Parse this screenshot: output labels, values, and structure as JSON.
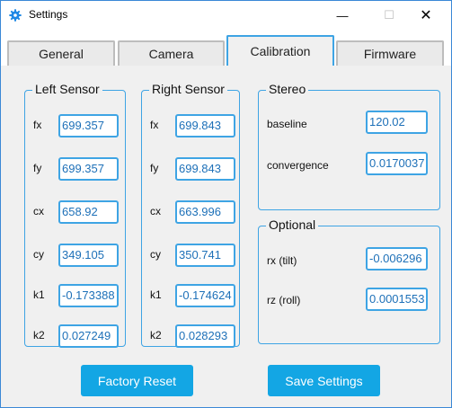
{
  "window": {
    "title": "Settings",
    "icon": "gear-icon",
    "minimize_glyph": "—",
    "maximize_glyph": "☐",
    "close_glyph": "✕"
  },
  "tabs": [
    {
      "label": "General",
      "active": false
    },
    {
      "label": "Camera",
      "active": false
    },
    {
      "label": "Calibration",
      "active": true
    },
    {
      "label": "Firmware",
      "active": false
    }
  ],
  "left_sensor": {
    "title": "Left Sensor",
    "rows": [
      {
        "label": "fx",
        "value": "699.357"
      },
      {
        "label": "fy",
        "value": "699.357"
      },
      {
        "label": "cx",
        "value": "658.92"
      },
      {
        "label": "cy",
        "value": "349.105"
      },
      {
        "label": "k1",
        "value": "-0.173388"
      },
      {
        "label": "k2",
        "value": "0.027249"
      }
    ]
  },
  "right_sensor": {
    "title": "Right Sensor",
    "rows": [
      {
        "label": "fx",
        "value": "699.843"
      },
      {
        "label": "fy",
        "value": "699.843"
      },
      {
        "label": "cx",
        "value": "663.996"
      },
      {
        "label": "cy",
        "value": "350.741"
      },
      {
        "label": "k1",
        "value": "-0.174624"
      },
      {
        "label": "k2",
        "value": "0.028293"
      }
    ]
  },
  "stereo": {
    "title": "Stereo",
    "rows": [
      {
        "label": "baseline",
        "value": "120.02"
      },
      {
        "label": "convergence",
        "value": "0.0170037"
      }
    ]
  },
  "optional": {
    "title": "Optional",
    "rows": [
      {
        "label": "rx (tilt)",
        "value": "-0.006296"
      },
      {
        "label": "rz (roll)",
        "value": "0.0001553"
      }
    ]
  },
  "buttons": {
    "factory_reset": "Factory Reset",
    "save_settings": "Save Settings"
  },
  "colors": {
    "accent": "#3ea4e4",
    "button": "#13a6e4",
    "field_text": "#1d70b8"
  }
}
